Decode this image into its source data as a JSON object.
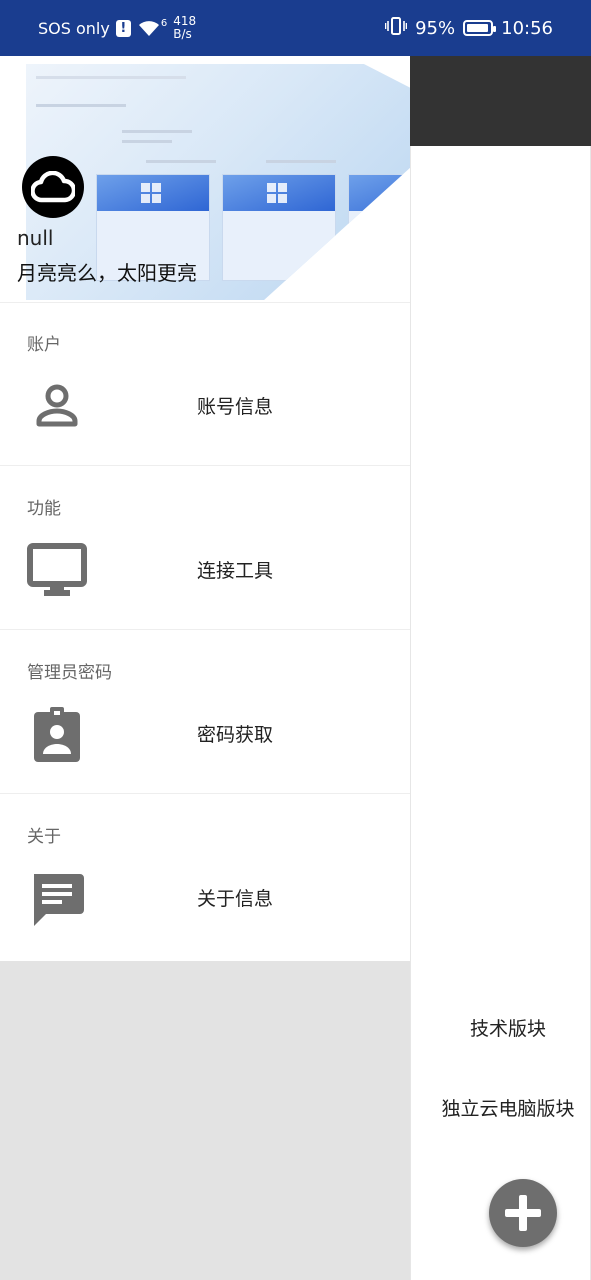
{
  "status_bar": {
    "carrier": "SOS only",
    "network": "6",
    "speed_value": "418",
    "speed_unit": "B/s",
    "battery": "95%",
    "battery_level": 0.95,
    "time": "10:56"
  },
  "drawer": {
    "username": "null",
    "motto": "月亮亮么，太阳更亮",
    "sections": [
      {
        "title": "账户",
        "item": "账号信息",
        "icon": "person-icon"
      },
      {
        "title": "功能",
        "item": "连接工具",
        "icon": "monitor-icon"
      },
      {
        "title": "管理员密码",
        "item": "密码获取",
        "icon": "badge-icon"
      },
      {
        "title": "关于",
        "item": "关于信息",
        "icon": "message-icon"
      }
    ]
  },
  "main": {
    "links": [
      "技术版块",
      "独立云电脑版块"
    ],
    "fab_icon": "plus-icon"
  },
  "colors": {
    "status_bar": "#1a3d8f",
    "app_bar": "#333333",
    "icon_gray": "#6e6e6e",
    "drawer_bottom": "#e3e3e3"
  }
}
